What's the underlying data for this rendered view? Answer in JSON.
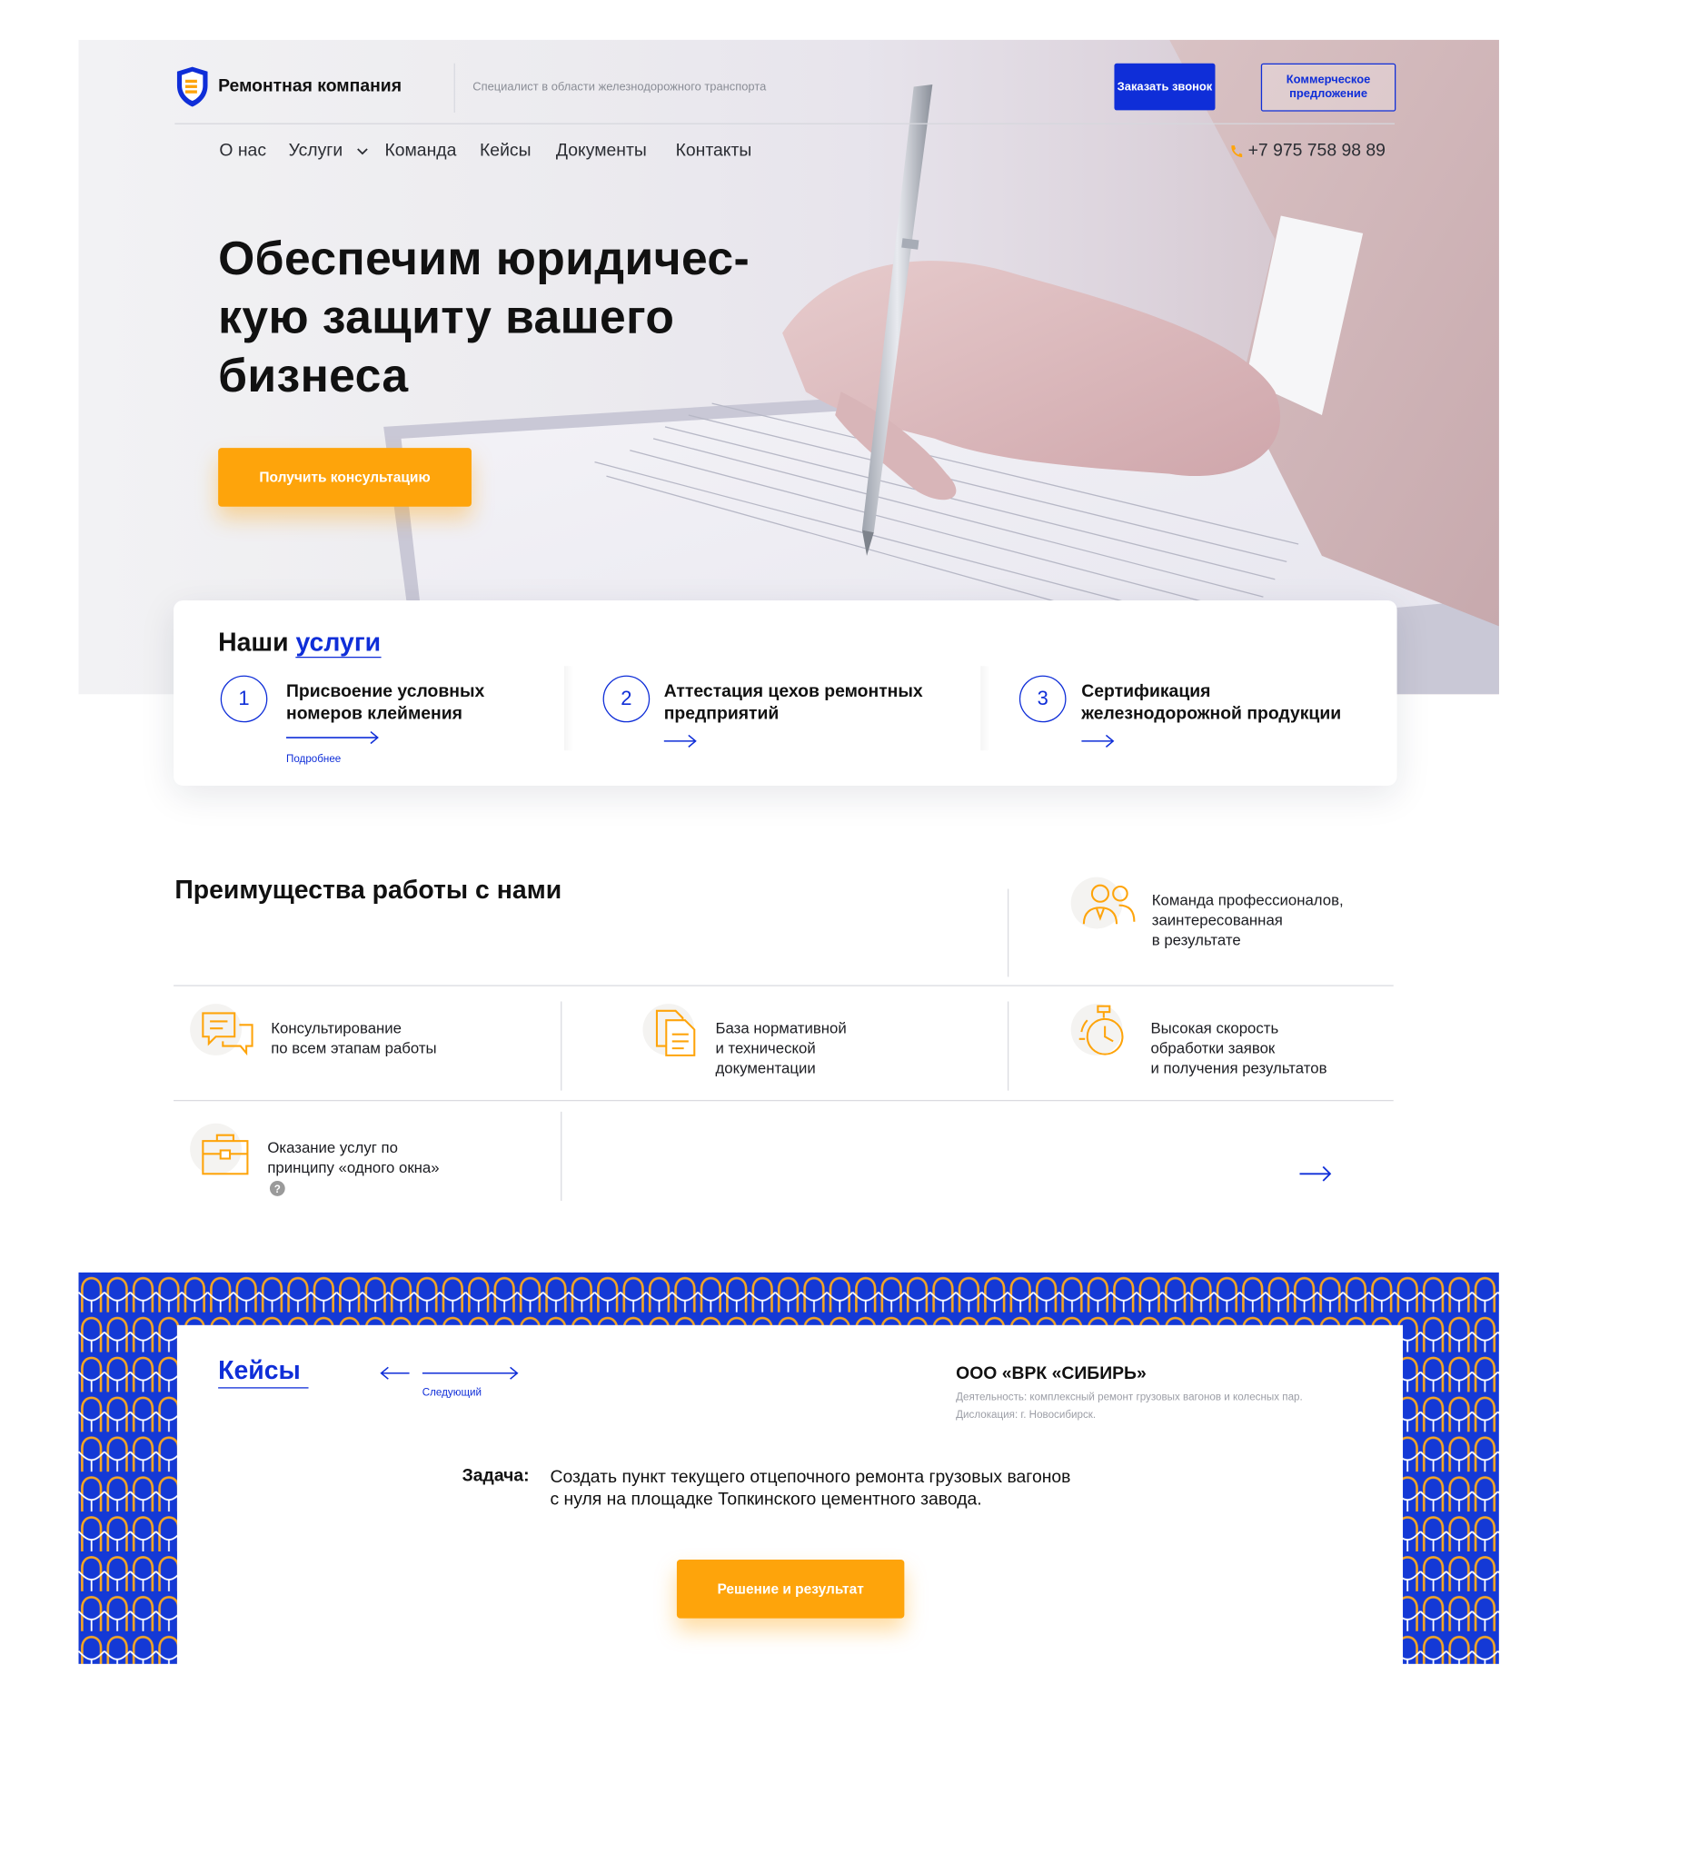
{
  "header": {
    "logo_name": "Ремонтная компания",
    "tagline": "Специалист в области железнодорожного транспорта",
    "call_button": "Заказать звонок",
    "offer_button": "Коммерческое предложение",
    "phone": "+7 975 758 98 89"
  },
  "nav": {
    "items": [
      "О нас",
      "Услуги",
      "Команда",
      "Кейсы",
      "Документы",
      "Контакты"
    ]
  },
  "hero": {
    "title_lines": [
      "Обеспечим юридичес-",
      "кую защиту вашего",
      "бизнеса"
    ],
    "cta": "Получить консультацию"
  },
  "services": {
    "title_plain": "Наши",
    "title_accent": "услуги",
    "items": [
      {
        "number": "1",
        "title_lines": [
          "Присвоение условных",
          "номеров клеймения"
        ],
        "link": "Подробнее"
      },
      {
        "number": "2",
        "title_lines": [
          "Аттестация цехов ремонтных",
          "предприятий"
        ]
      },
      {
        "number": "3",
        "title_lines": [
          "Сертификация",
          "железнодорожной продукции"
        ]
      }
    ]
  },
  "advantages": {
    "title": "Преимущества работы с нами",
    "items": [
      {
        "icon": "team-icon",
        "lines": [
          "Команда профессионалов,",
          "заинтересованная",
          "в результате"
        ]
      },
      {
        "icon": "chat-icon",
        "lines": [
          "Консультирование",
          "по всем этапам работы"
        ]
      },
      {
        "icon": "documents-icon",
        "lines": [
          "База нормативной",
          "и технической",
          "документации"
        ]
      },
      {
        "icon": "stopwatch-icon",
        "lines": [
          "Высокая скорость",
          "обработки заявок",
          "и получения результатов"
        ]
      },
      {
        "icon": "briefcase-icon",
        "lines": [
          "Оказание услуг по",
          "принципу «одного окна»"
        ],
        "help": "?"
      }
    ]
  },
  "cases": {
    "title": "Кейсы",
    "next_label": "Следующий",
    "company": "ООО «ВРК «СИБИРЬ»",
    "activity": "Деятельность: комплексный ремонт грузовых вагонов и колесных пар.",
    "location": "Дислокация: г. Новосибирск.",
    "task_label": "Задача:",
    "task_lines": [
      "Создать пункт текущего отцепочного ремонта грузовых вагонов",
      "с нуля на площадке Топкинского цементного завода."
    ],
    "result_button": "Решение и результат"
  },
  "colors": {
    "accent_blue": "#0f2ed8",
    "accent_orange": "#fea40b",
    "pattern_blue": "#1439d6"
  }
}
